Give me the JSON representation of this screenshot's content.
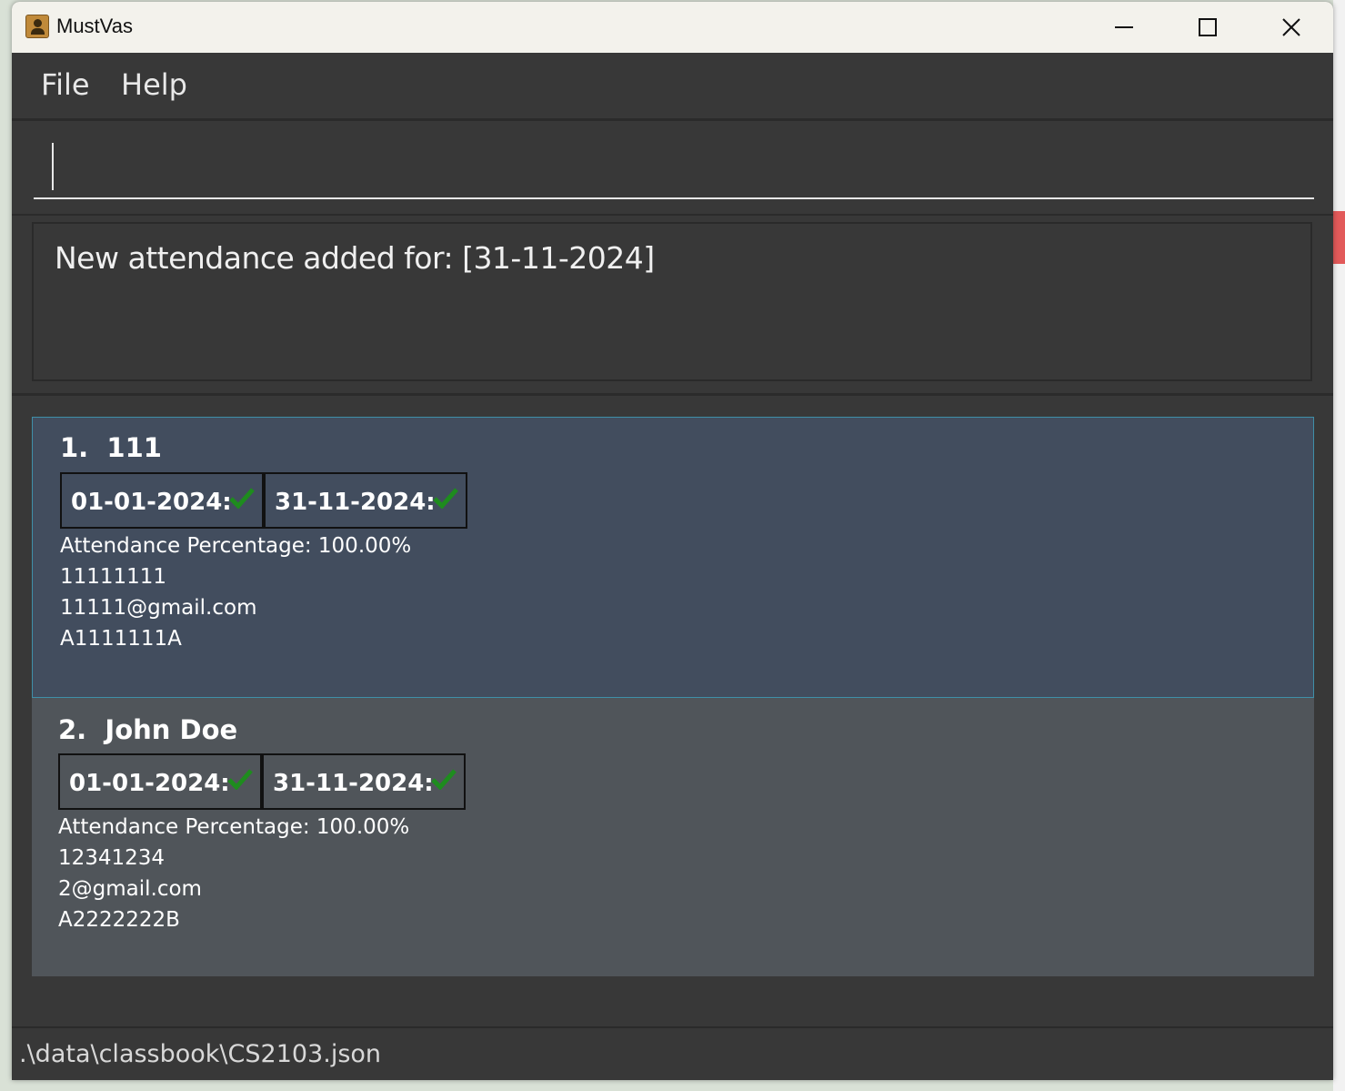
{
  "window": {
    "title": "MustVas"
  },
  "menu": {
    "file": "File",
    "help": "Help"
  },
  "command": {
    "value": ""
  },
  "result": {
    "message": "New attendance added for: [31-11-2024]"
  },
  "persons": [
    {
      "index": "1.",
      "name": "111",
      "attendance": [
        {
          "date": "01-01-2024:",
          "status": "present"
        },
        {
          "date": "31-11-2024:",
          "status": "present"
        }
      ],
      "attendance_percentage": "Attendance Percentage: 100.00%",
      "phone": "11111111",
      "email": "11111@gmail.com",
      "student_id": "A1111111A",
      "selected": true
    },
    {
      "index": "2.",
      "name": "John Doe",
      "attendance": [
        {
          "date": "01-01-2024:",
          "status": "present"
        },
        {
          "date": "31-11-2024:",
          "status": "present"
        }
      ],
      "attendance_percentage": "Attendance Percentage: 100.00%",
      "phone": "12341234",
      "email": "2@gmail.com",
      "student_id": "A2222222B",
      "selected": false
    }
  ],
  "status": {
    "file_path": ".\\data\\classbook\\CS2103.json"
  },
  "colors": {
    "background": "#383838",
    "selected_card": "#424d5e",
    "card": "#50555a",
    "check": "#1e8c1e"
  },
  "icons": {
    "app": "address-book-icon",
    "check": "checkmark-icon",
    "minimize": "minimize-icon",
    "maximize": "maximize-icon",
    "close": "close-icon"
  }
}
